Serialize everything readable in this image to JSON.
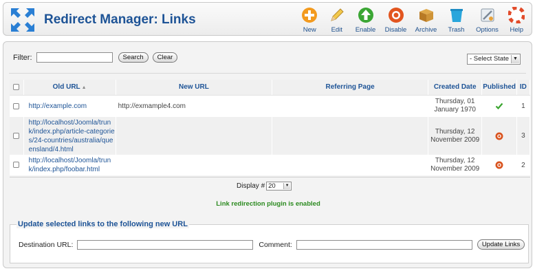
{
  "header": {
    "title": "Redirect Manager: Links",
    "logo_icon": "redirect-arrows-icon",
    "toolbar": [
      {
        "label": "New",
        "icon": "plus-circle-icon",
        "color": "#f39a1e"
      },
      {
        "label": "Edit",
        "icon": "pencil-icon",
        "color": "#e6b422"
      },
      {
        "label": "Enable",
        "icon": "arrow-up-circle-icon",
        "color": "#3ba634"
      },
      {
        "label": "Disable",
        "icon": "stop-circle-icon",
        "color": "#e2551f"
      },
      {
        "label": "Archive",
        "icon": "box-icon",
        "color": "#c88a2a"
      },
      {
        "label": "Trash",
        "icon": "trash-icon",
        "color": "#2aa6dc"
      },
      {
        "label": "Options",
        "icon": "options-icon",
        "color": "#7a8896"
      },
      {
        "label": "Help",
        "icon": "lifebuoy-icon",
        "color": "#e24b2a"
      }
    ]
  },
  "filter": {
    "label": "Filter:",
    "value": "",
    "search_label": "Search",
    "clear_label": "Clear",
    "state_select": "- Select State -"
  },
  "table": {
    "columns": {
      "old_url": "Old URL",
      "new_url": "New URL",
      "referring": "Referring Page",
      "created": "Created Date",
      "published": "Published",
      "id": "ID"
    },
    "rows": [
      {
        "old_url": "http://example.com",
        "new_url": "http://exmample4.com",
        "referring": "",
        "created": "Thursday, 01 January 1970",
        "published": "enabled",
        "id": "1"
      },
      {
        "old_url": "http://localhost/Joomla/trunk/index.php/article-categories/24-countries/australia/queensland/4.html",
        "new_url": "",
        "referring": "",
        "created": "Thursday, 12 November 2009",
        "published": "disabled",
        "id": "3"
      },
      {
        "old_url": "http://localhost/Joomla/trunk/index.php/foobar.html",
        "new_url": "",
        "referring": "",
        "created": "Thursday, 12 November 2009",
        "published": "disabled",
        "id": "2"
      }
    ]
  },
  "pagination": {
    "display_label": "Display #",
    "display_value": "20"
  },
  "status": {
    "message": "Link redirection plugin is enabled",
    "color": "#2b8a1f"
  },
  "update": {
    "legend": "Update selected links to the following new URL",
    "dest_label": "Destination URL:",
    "dest_value": "",
    "comment_label": "Comment:",
    "comment_value": "",
    "button_label": "Update Links"
  }
}
